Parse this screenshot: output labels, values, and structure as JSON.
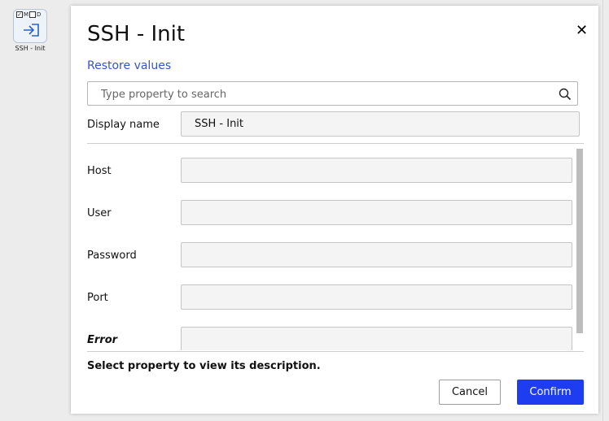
{
  "canvas": {
    "node": {
      "flags": [
        "M",
        "D"
      ],
      "flag_m_checked": true,
      "flag_d_checked": false,
      "label": "SSH - Init",
      "icon": "login-arrow-icon"
    }
  },
  "dialog": {
    "title": "SSH - Init",
    "close_label": "✕",
    "restore_label": "Restore values",
    "search": {
      "placeholder": "Type property to search",
      "value": ""
    },
    "display_name": {
      "label": "Display name",
      "value": "SSH - Init"
    },
    "properties": [
      {
        "label": "Host",
        "value": ""
      },
      {
        "label": "User",
        "value": ""
      },
      {
        "label": "Password",
        "value": ""
      },
      {
        "label": "Port",
        "value": ""
      },
      {
        "label": "Error",
        "value": ""
      }
    ],
    "description": "Select property to view its description.",
    "buttons": {
      "cancel": "Cancel",
      "confirm": "Confirm"
    }
  },
  "colors": {
    "accent": "#1f3df0",
    "link": "#3554c7"
  }
}
